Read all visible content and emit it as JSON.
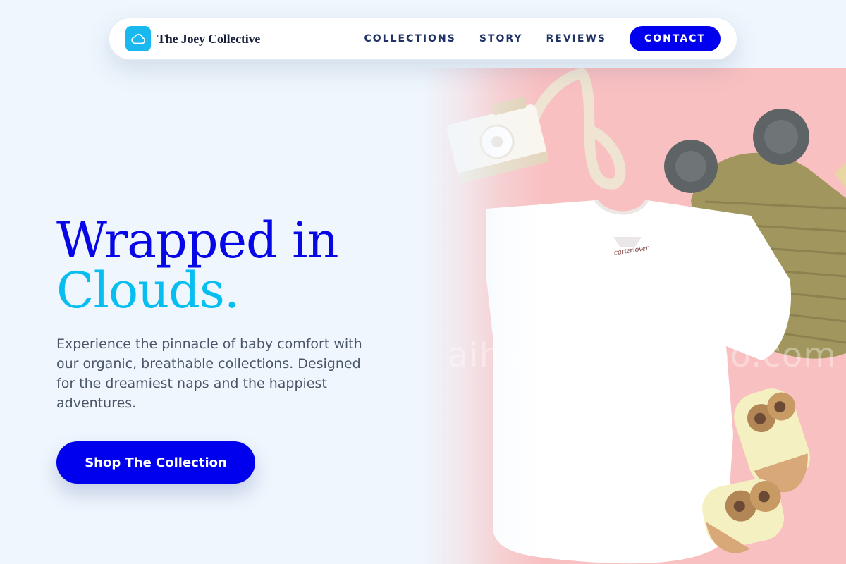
{
  "brand": {
    "name": "The Joey Collective",
    "logo_icon": "cloud-icon",
    "logo_color": "#19b8ee"
  },
  "nav": {
    "links": [
      {
        "label": "COLLECTIONS"
      },
      {
        "label": "STORY"
      },
      {
        "label": "REVIEWS"
      }
    ],
    "cta_label": "CONTACT"
  },
  "hero": {
    "title_line1": "Wrapped in",
    "title_line2": "Clouds.",
    "description": "Experience the pinnacle of baby comfort with our organic, breathable collections. Designed for the dreamiest naps and the happiest adventures.",
    "cta_label": "Shop The Collection",
    "image": {
      "watermark": "aihappykangaroo.com",
      "tag_text": "carterlover"
    }
  },
  "colors": {
    "accent": "#0000ee",
    "title_primary": "#0606e6",
    "title_secondary": "#06bff0",
    "background": "#eff6fd",
    "photo_background": "#f9c0c1"
  }
}
